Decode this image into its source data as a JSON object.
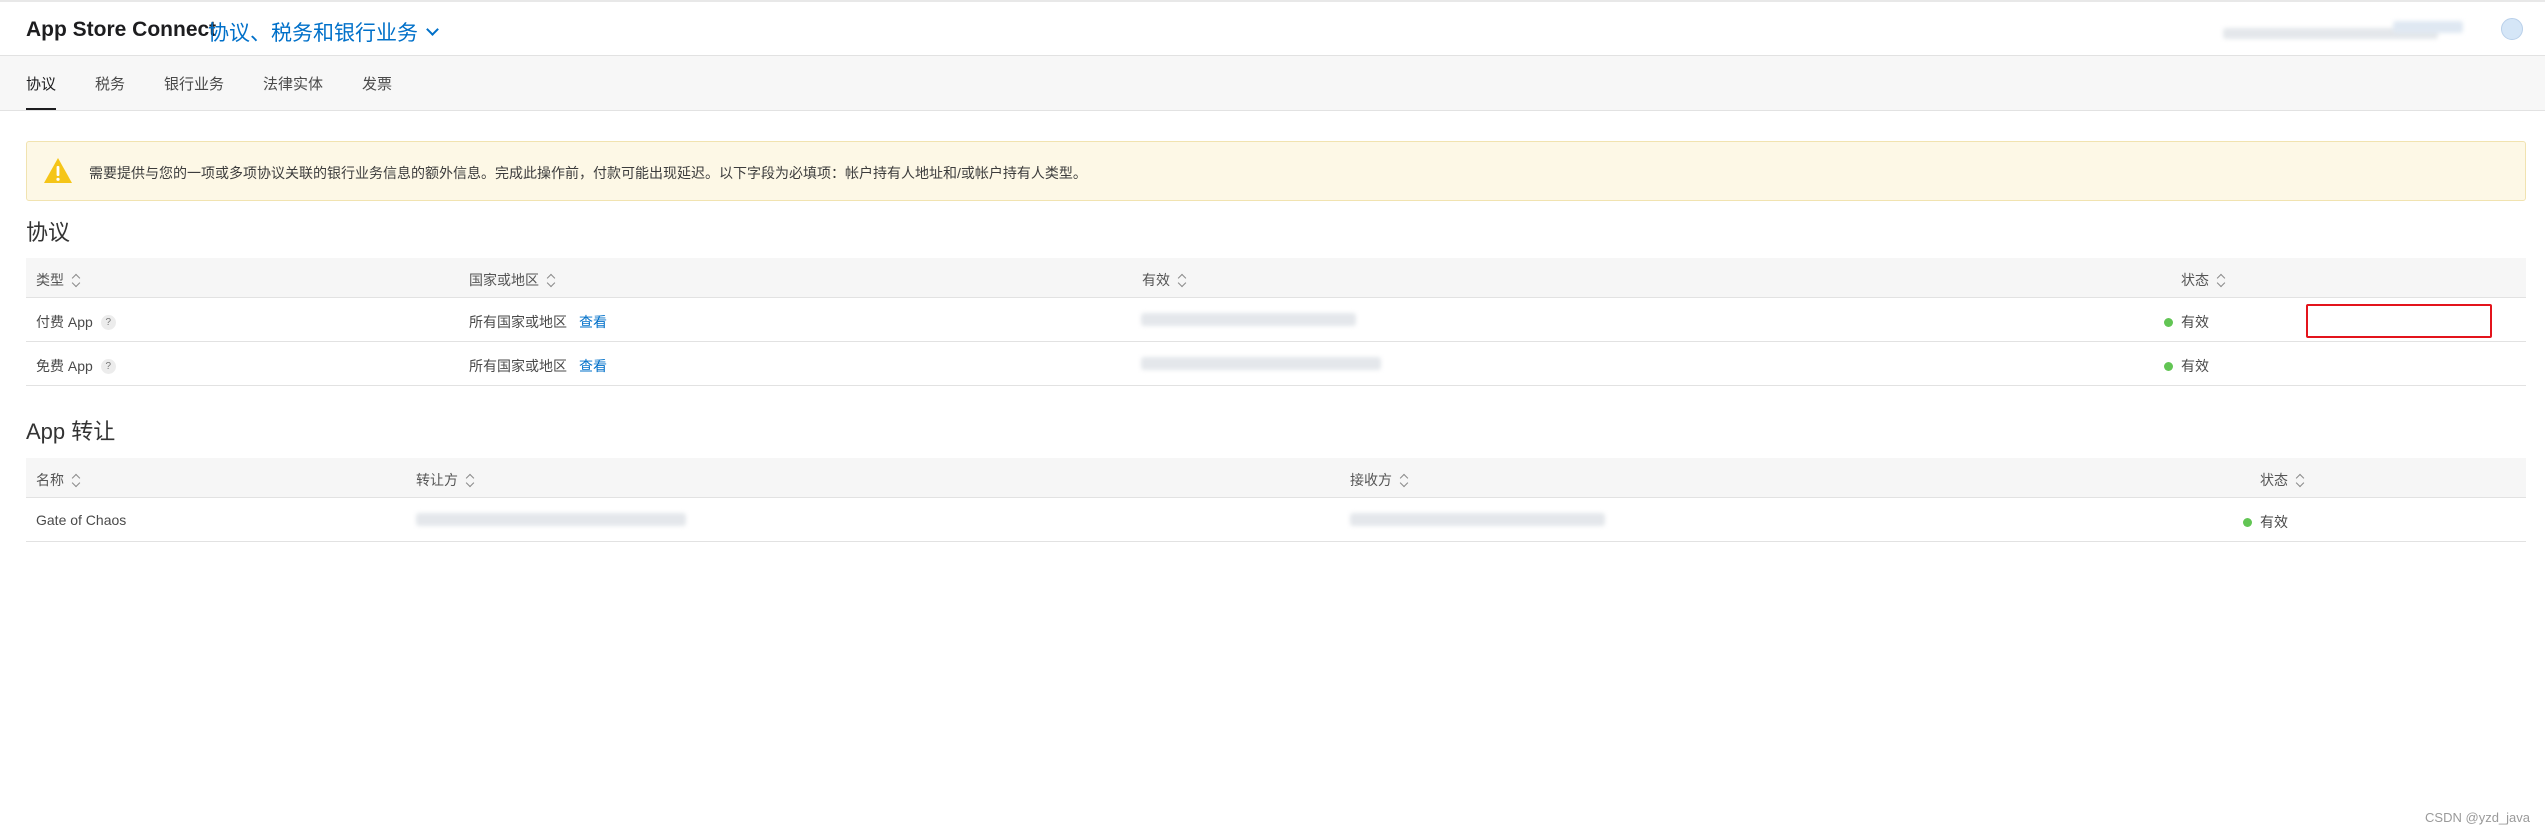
{
  "header": {
    "app_title": "App Store Connect",
    "section_title": "协议、税务和银行业务"
  },
  "tabs": [
    {
      "label": "协议",
      "active": true
    },
    {
      "label": "税务",
      "active": false
    },
    {
      "label": "银行业务",
      "active": false
    },
    {
      "label": "法律实体",
      "active": false
    },
    {
      "label": "发票",
      "active": false
    }
  ],
  "banner": {
    "icon": "warning-icon",
    "text": "需要提供与您的一项或多项协议关联的银行业务信息的额外信息。完成此操作前，付款可能出现延迟。以下字段为必填项：帐户持有人地址和/或帐户持有人类型。"
  },
  "agreements": {
    "heading": "协议",
    "columns": [
      "类型",
      "国家或地区",
      "有效",
      "状态"
    ],
    "rows": [
      {
        "type": "付费 App",
        "region": "所有国家或地区",
        "view": "查看",
        "status": "有效"
      },
      {
        "type": "免费 App",
        "region": "所有国家或地区",
        "view": "查看",
        "status": "有效"
      }
    ]
  },
  "transfers": {
    "heading": "App 转让",
    "columns": [
      "名称",
      "转让方",
      "接收方",
      "状态"
    ],
    "rows": [
      {
        "name": "Gate of Chaos",
        "status": "有效"
      }
    ]
  },
  "colors": {
    "accent": "#0070c9",
    "status_active": "#62c554",
    "warning": "#f5c518",
    "highlight": "#e3141c"
  },
  "watermark": "CSDN @yzd_java"
}
